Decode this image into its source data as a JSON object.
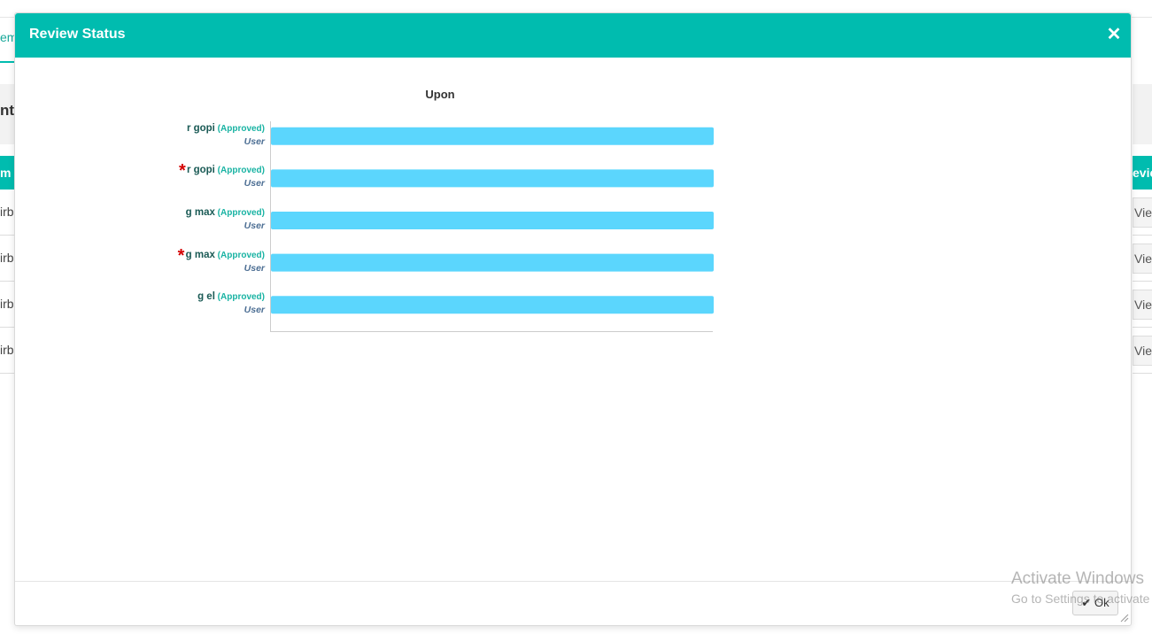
{
  "background": {
    "tab_fragment": "em",
    "heading_fragment": "nt(",
    "table_header_left": "m",
    "table_header_right": "evie",
    "row_fragments": [
      "irb",
      "irb",
      "irb",
      "irb"
    ],
    "view_label": "View"
  },
  "modal": {
    "title": "Review Status",
    "close_icon": "✕",
    "ok_label": "Ok"
  },
  "chart_data": {
    "type": "bar",
    "orientation": "horizontal",
    "title": "Upon",
    "categories": [
      {
        "name": "r gopi",
        "status": "(Approved)",
        "role": "User",
        "starred": false
      },
      {
        "name": "r gopi",
        "status": "(Approved)",
        "role": "User",
        "starred": true
      },
      {
        "name": "g max",
        "status": "(Approved)",
        "role": "User",
        "starred": false
      },
      {
        "name": "g max",
        "status": "(Approved)",
        "role": "User",
        "starred": true
      },
      {
        "name": "g el",
        "status": "(Approved)",
        "role": "User",
        "starred": false
      }
    ],
    "values": [
      1,
      1,
      1,
      1,
      1
    ],
    "xlim": [
      0,
      1
    ],
    "bar_color": "#5bd6fd",
    "grid": false
  },
  "watermark": {
    "title": "Activate Windows",
    "subtitle": "Go to Settings to activate Windows."
  },
  "colors": {
    "accent": "#00bcaf",
    "bar": "#5bd6fd",
    "star": "#d40000"
  }
}
